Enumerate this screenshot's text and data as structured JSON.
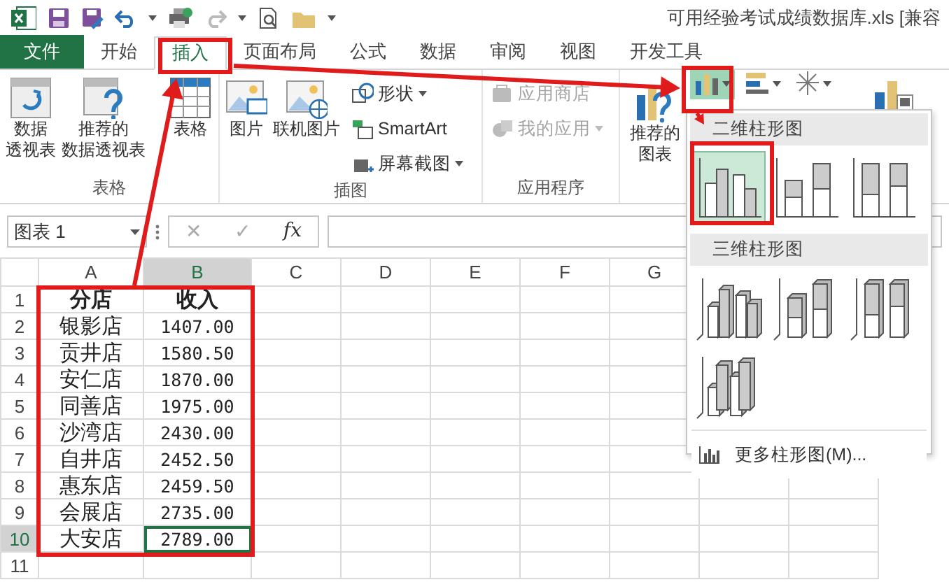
{
  "title": "可用经验考试成绩数据库.xls  [兼容",
  "tabs": [
    {
      "label": "文件",
      "kind": "file",
      "selected": false
    },
    {
      "label": "开始",
      "kind": "tab",
      "selected": false
    },
    {
      "label": "插入",
      "kind": "tab",
      "selected": true
    },
    {
      "label": "页面布局",
      "kind": "tab",
      "selected": false
    },
    {
      "label": "公式",
      "kind": "tab",
      "selected": false
    },
    {
      "label": "数据",
      "kind": "tab",
      "selected": false
    },
    {
      "label": "审阅",
      "kind": "tab",
      "selected": false
    },
    {
      "label": "视图",
      "kind": "tab",
      "selected": false
    },
    {
      "label": "开发工具",
      "kind": "tab",
      "selected": false
    }
  ],
  "ribbon": {
    "groups": [
      {
        "label": "表格",
        "buttons": [
          {
            "kind": "pivot",
            "lines": [
              "数据",
              "透视表"
            ]
          },
          {
            "kind": "recommended_pivot",
            "lines": [
              "推荐的",
              "数据透视表"
            ]
          },
          {
            "kind": "table",
            "lines": [
              "表格"
            ]
          }
        ]
      },
      {
        "label": "插图",
        "buttons": [
          {
            "kind": "picture",
            "lines": [
              "图片"
            ]
          },
          {
            "kind": "online_picture",
            "lines": [
              "联机图片"
            ]
          }
        ],
        "small_buttons": [
          {
            "kind": "shapes",
            "label": "形状",
            "dropdown": true,
            "disabled": false
          },
          {
            "kind": "smartart",
            "label": "SmartArt",
            "dropdown": false,
            "disabled": false
          },
          {
            "kind": "screenshot",
            "label": "屏幕截图",
            "dropdown": true,
            "disabled": false
          }
        ]
      },
      {
        "label": "应用程序",
        "small_buttons": [
          {
            "kind": "store",
            "label": "应用商店",
            "dropdown": false,
            "disabled": true
          },
          {
            "kind": "my_apps",
            "label": "我的应用",
            "dropdown": true,
            "disabled": true
          }
        ]
      }
    ],
    "recommended_charts": {
      "lines": [
        "推荐的",
        "图表"
      ]
    },
    "chart_buttons": [
      {
        "kind": "column",
        "selected": true
      },
      {
        "kind": "bar",
        "selected": false
      },
      {
        "kind": "scatter",
        "selected": false
      }
    ]
  },
  "formula_bar": {
    "name_box": "图表 1",
    "cancel": "✕",
    "enter": "✓",
    "function": "fx"
  },
  "columns": [
    {
      "label": "A",
      "selected": false
    },
    {
      "label": "B",
      "selected": true
    },
    {
      "label": "C",
      "selected": false
    },
    {
      "label": "D",
      "selected": false
    },
    {
      "label": "E",
      "selected": false
    },
    {
      "label": "F",
      "selected": false
    },
    {
      "label": "G",
      "selected": false
    }
  ],
  "rows": [
    {
      "label": "1",
      "selected": false,
      "cells": [
        {
          "text": "分店",
          "bold": true,
          "active": false
        },
        {
          "text": "收入",
          "bold": true,
          "active": false
        }
      ]
    },
    {
      "label": "2",
      "selected": false,
      "cells": [
        {
          "text": "银影店",
          "bold": false,
          "active": false
        },
        {
          "text": "1407.00",
          "bold": false,
          "active": false
        }
      ]
    },
    {
      "label": "3",
      "selected": false,
      "cells": [
        {
          "text": "贡井店",
          "bold": false,
          "active": false
        },
        {
          "text": "1580.50",
          "bold": false,
          "active": false
        }
      ]
    },
    {
      "label": "4",
      "selected": false,
      "cells": [
        {
          "text": "安仁店",
          "bold": false,
          "active": false
        },
        {
          "text": "1870.00",
          "bold": false,
          "active": false
        }
      ]
    },
    {
      "label": "5",
      "selected": false,
      "cells": [
        {
          "text": "同善店",
          "bold": false,
          "active": false
        },
        {
          "text": "1975.00",
          "bold": false,
          "active": false
        }
      ]
    },
    {
      "label": "6",
      "selected": false,
      "cells": [
        {
          "text": "沙湾店",
          "bold": false,
          "active": false
        },
        {
          "text": "2430.00",
          "bold": false,
          "active": false
        }
      ]
    },
    {
      "label": "7",
      "selected": false,
      "cells": [
        {
          "text": "自井店",
          "bold": false,
          "active": false
        },
        {
          "text": "2452.50",
          "bold": false,
          "active": false
        }
      ]
    },
    {
      "label": "8",
      "selected": false,
      "cells": [
        {
          "text": "惠东店",
          "bold": false,
          "active": false
        },
        {
          "text": "2459.50",
          "bold": false,
          "active": false
        }
      ]
    },
    {
      "label": "9",
      "selected": false,
      "cells": [
        {
          "text": "会展店",
          "bold": false,
          "active": false
        },
        {
          "text": "2735.00",
          "bold": false,
          "active": false
        }
      ]
    },
    {
      "label": "10",
      "selected": true,
      "cells": [
        {
          "text": "大安店",
          "bold": false,
          "active": false
        },
        {
          "text": "2789.00",
          "bold": false,
          "active": true
        }
      ]
    },
    {
      "label": "11",
      "selected": false,
      "cells": []
    }
  ],
  "chart_menu": {
    "sections": [
      {
        "title": "二维柱形图",
        "items": [
          {
            "kind": "clustered",
            "selected": true
          },
          {
            "kind": "stacked",
            "selected": false
          },
          {
            "kind": "percent",
            "selected": false
          }
        ]
      },
      {
        "title": "三维柱形图",
        "items": [
          {
            "kind": "clustered3d",
            "selected": false
          },
          {
            "kind": "stacked3d",
            "selected": false
          },
          {
            "kind": "percent3d",
            "selected": false
          },
          {
            "kind": "column3d",
            "selected": false
          }
        ]
      }
    ],
    "more": "更多柱形图(M)..."
  }
}
